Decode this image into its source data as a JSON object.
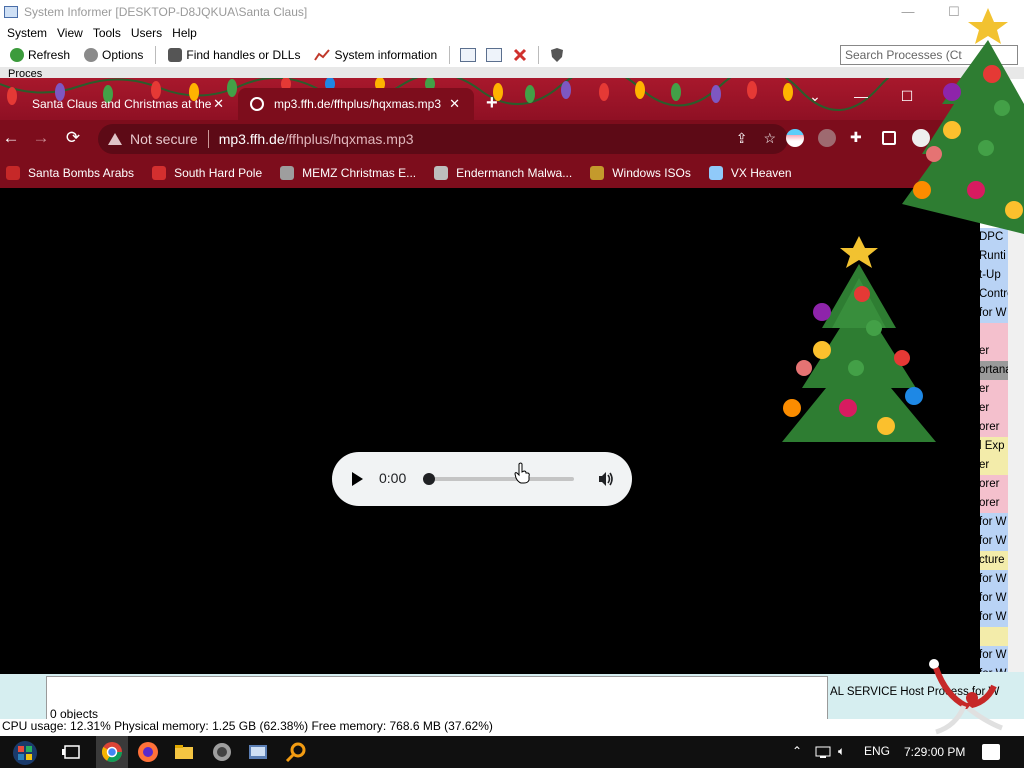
{
  "system_informer": {
    "title": "System Informer [DESKTOP-D8JQKUA\\Santa Claus]",
    "window_controls": {
      "minimize": "—",
      "maximize": "☐",
      "close": "✕"
    },
    "menu": [
      "System",
      "View",
      "Tools",
      "Users",
      "Help"
    ],
    "toolbar": {
      "refresh": "Refresh",
      "options": "Options",
      "find_handles": "Find handles or DLLs",
      "system_information": "System information"
    },
    "search_placeholder": "Search Processes (Ct",
    "processes_tab": "Proces",
    "right_column_items": [
      {
        "text": "DPC",
        "color": "#b9d3f5"
      },
      {
        "text": "Runti",
        "color": "#b9d3f5"
      },
      {
        "text": "t-Up",
        "color": "#b9d3f5"
      },
      {
        "text": "Contro",
        "color": "#b9d3f5"
      },
      {
        "text": "for W",
        "color": "#b9d3f5"
      },
      {
        "text": "",
        "color": "#f4c0cd"
      },
      {
        "text": "er",
        "color": "#f4c0cd"
      },
      {
        "text": "ortana",
        "color": "#9a9a9a"
      },
      {
        "text": "er",
        "color": "#f4c0cd"
      },
      {
        "text": "er",
        "color": "#f4c0cd"
      },
      {
        "text": "orer",
        "color": "#f4c0cd"
      },
      {
        "text": "l Exp",
        "color": "#f3ecaa"
      },
      {
        "text": "er",
        "color": "#f3ecaa"
      },
      {
        "text": "orer",
        "color": "#f4c0cd"
      },
      {
        "text": "orer",
        "color": "#f4c0cd"
      },
      {
        "text": "for W",
        "color": "#b9d3f5"
      },
      {
        "text": "for W",
        "color": "#b9d3f5"
      },
      {
        "text": "cture",
        "color": "#f3ecaa"
      },
      {
        "text": "for W",
        "color": "#b9d3f5"
      },
      {
        "text": "for W",
        "color": "#b9d3f5"
      },
      {
        "text": "for W",
        "color": "#b9d3f5"
      },
      {
        "text": "",
        "color": "#f3ecaa"
      },
      {
        "text": "for W",
        "color": "#b9d3f5"
      },
      {
        "text": "for W",
        "color": "#b9d3f5"
      }
    ],
    "service_row": "AL SERVICE     Host Process for W",
    "objects_count": "0 objects",
    "status_bar": "CPU usage: 12.31%    Physical memory: 1.25 GB (62.38%)    Free memory: 768.6 MB (37.62%)"
  },
  "chrome": {
    "tabs": [
      {
        "title": "Santa Claus and Christmas at the",
        "active": false
      },
      {
        "title": "mp3.ffh.de/ffhplus/hqxmas.mp3",
        "active": true
      }
    ],
    "new_tab_symbol": "+",
    "window_controls": {
      "tab_search": "⌄",
      "minimize": "—",
      "maximize": "☐",
      "close": "✕"
    },
    "nav": {
      "back": "←",
      "forward": "→",
      "reload": "⟳"
    },
    "omnibox": {
      "security_label": "Not secure",
      "url_host": "mp3.ffh.de",
      "url_path": "/ffhplus/hqxmas.mp3"
    },
    "bookmarks": [
      {
        "label": "Santa Bombs Arabs",
        "icon": "santa-icon",
        "color": "#c62828"
      },
      {
        "label": "South Hard Pole",
        "icon": "snowflake-icon",
        "color": "#d32f2f"
      },
      {
        "label": "MEMZ Christmas E...",
        "icon": "memz-icon",
        "color": "#9e9e9e"
      },
      {
        "label": "Endermanch Malwa...",
        "icon": "raccoon-icon",
        "color": "#bdbdbd"
      },
      {
        "label": "Windows ISOs",
        "icon": "windows-icon",
        "color": "#c49a2c"
      },
      {
        "label": "VX Heaven",
        "icon": "vx-icon",
        "color": "#90caf9"
      }
    ],
    "audio_player": {
      "current_time": "0:00",
      "progress": 0.0
    }
  },
  "taskbar": {
    "apps": [
      "start-icon",
      "task-view-icon",
      "chrome-icon",
      "firefox-icon",
      "file-explorer-icon",
      "app-icon",
      "system-informer-icon",
      "search-tool-icon"
    ],
    "language": "ENG",
    "clock": "7:29:00 PM"
  }
}
